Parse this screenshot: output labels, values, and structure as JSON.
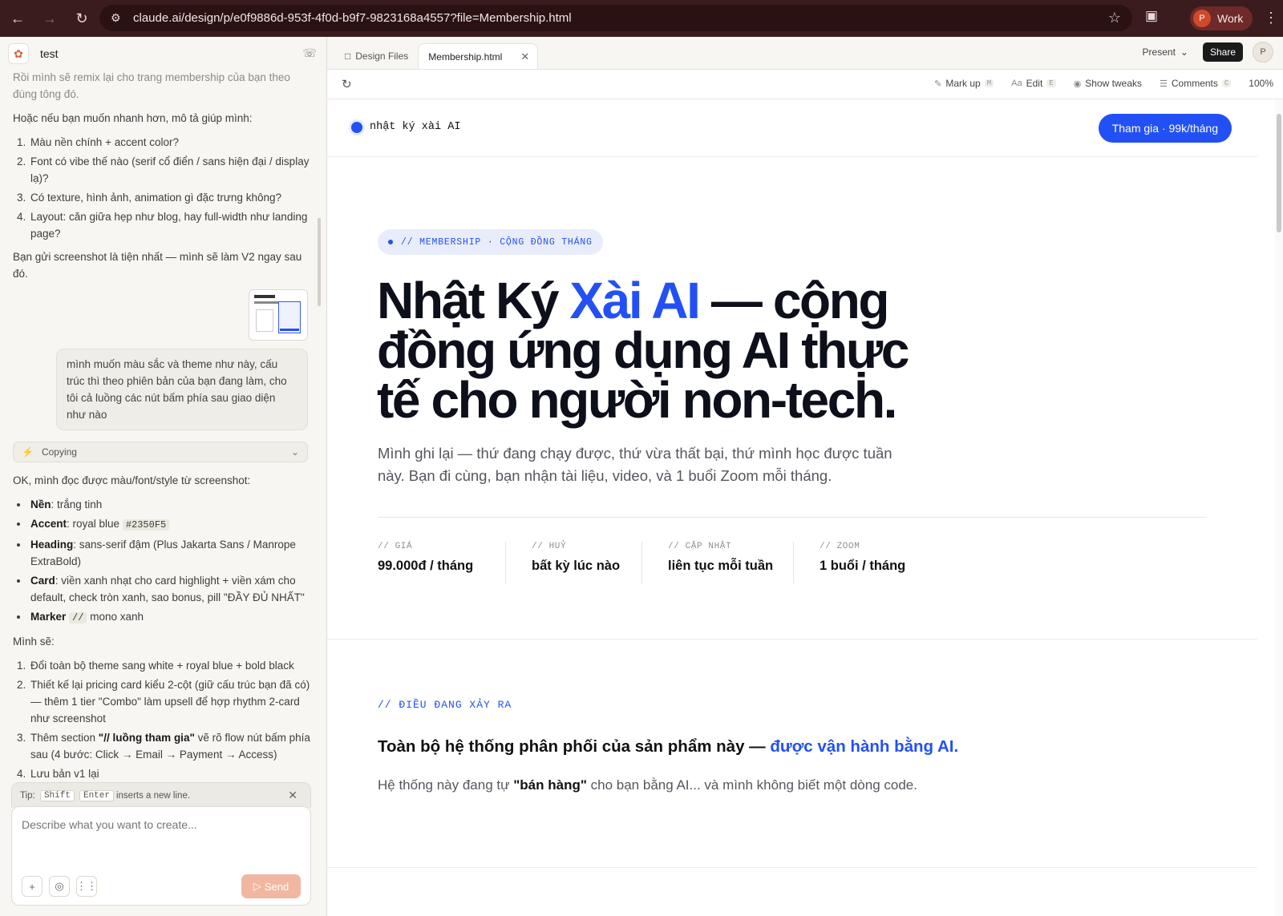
{
  "browser": {
    "url": "claude.ai/design/p/e0f9886d-953f-4f0d-b9f7-9823168a4557?file=Membership.html",
    "profile_initial": "P",
    "profile_name": "Work"
  },
  "chat": {
    "title": "test",
    "faded_top": "Rồi mình sẽ remix lại cho trang membership của bạn theo đúng tông đó.",
    "intro": "Hoặc nếu bạn muốn nhanh hơn, mô tả giúp mình:",
    "questions": [
      "Màu nền chính + accent color?",
      "Font có vibe thế nào (serif cổ điển / sans hiện đại / display lạ)?",
      "Có texture, hình ảnh, animation gì đặc trưng không?",
      "Layout: căn giữa hẹp như blog, hay full-width như landing page?"
    ],
    "after_questions": "Bạn gửi screenshot là tiện nhất — mình sẽ làm V2 ngay sau đó.",
    "user_message": "mình muốn màu sắc và theme như này, cấu trúc thì theo phiên bản của bạn đang làm, cho tôi cả luồng các nút bấm phía sau giao diện như nào",
    "tool_label": "Copying",
    "reply_intro": "OK, mình đọc được màu/font/style từ screenshot:",
    "bullets": [
      {
        "key": "Nền",
        "text": ": trắng tinh"
      },
      {
        "key": "Accent",
        "text": ": royal blue ",
        "code": "#2350F5"
      },
      {
        "key": "Heading",
        "text": ": sans-serif đậm (Plus Jakarta Sans / Manrope ExtraBold)"
      },
      {
        "key": "Card",
        "text": ": viền xanh nhạt cho card highlight + viền xám cho default, check tròn xanh, sao bonus, pill \"ĐẦY ĐỦ NHẤT\""
      },
      {
        "key": "Marker",
        "code": "//",
        "text": " mono xanh"
      }
    ],
    "plan_intro": "Mình sẽ:",
    "plan": [
      {
        "text": "Đổi toàn bộ theme sang white + royal blue + bold black"
      },
      {
        "text": "Thiết kế lại pricing card kiểu 2-cột (giữ cấu trúc bạn đã có) — thêm 1 tier \"Combo\" làm upsell để hợp rhythm 2-card như screenshot"
      },
      {
        "pre": "Thêm section ",
        "bold": "\"// luồng tham gia\"",
        "post": " vẽ rõ flow nút bấm phía sau (4 bước: Click → Email → Payment → Access)"
      },
      {
        "text": "Lưu bản v1 lại"
      }
    ],
    "tip_prefix": "Tip:",
    "tip_key1": "Shift",
    "tip_key2": "Enter",
    "tip_suffix": "inserts a new line.",
    "composer_placeholder": "Describe what you want to create...",
    "send_label": "Send"
  },
  "tabs": [
    {
      "label": "Design Files"
    },
    {
      "label": "Membership.html"
    }
  ],
  "header_right": {
    "present": "Present",
    "share": "Share",
    "avatar": "P"
  },
  "toolbar": {
    "markup": "Mark up",
    "markup_key": "M",
    "edit": "Edit",
    "edit_key": "E",
    "tweaks": "Show tweaks",
    "comments": "Comments",
    "comments_key": "C",
    "zoom": "100%"
  },
  "preview": {
    "brand": "nhật ký xài AI",
    "join_button": "Tham gia · 99k/tháng",
    "pill": "// MEMBERSHIP · CỘNG ĐỒNG THÁNG",
    "h1_pre": "Nhật Ký ",
    "h1_accent": "Xài AI",
    "h1_post": " — cộng đồng ứng dụng AI thực tế cho người non-tech.",
    "subtitle": "Mình ghi lại — thứ đang chạy được, thứ vừa thất bại, thứ mình học được tuần này. Bạn đi cùng, bạn nhận tài liệu, video, và 1 buổi Zoom mỗi tháng.",
    "stats": [
      {
        "label": "// GIÁ",
        "value": "99.000đ / tháng"
      },
      {
        "label": "// HUỶ",
        "value": "bất kỳ lúc nào"
      },
      {
        "label": "// CẬP NHẬT",
        "value": "liên tục mỗi tuần"
      },
      {
        "label": "// ZOOM",
        "value": "1 buổi / tháng"
      }
    ],
    "section_label": "// ĐIỀU ĐANG XẢY RA",
    "section_h2_pre": "Toàn bộ hệ thống phân phối của sản phẩm này — ",
    "section_h2_accent": "được vận hành bằng AI.",
    "section_p_pre": "Hệ thống này đang tự ",
    "section_p_bold": "\"bán hàng\"",
    "section_p_post": " cho bạn bằng AI... và mình không biết một dòng code."
  },
  "colors": {
    "accent": "#2350F5",
    "browser_bg": "#3b1c1e",
    "send_disabled": "#f2b7a1"
  }
}
